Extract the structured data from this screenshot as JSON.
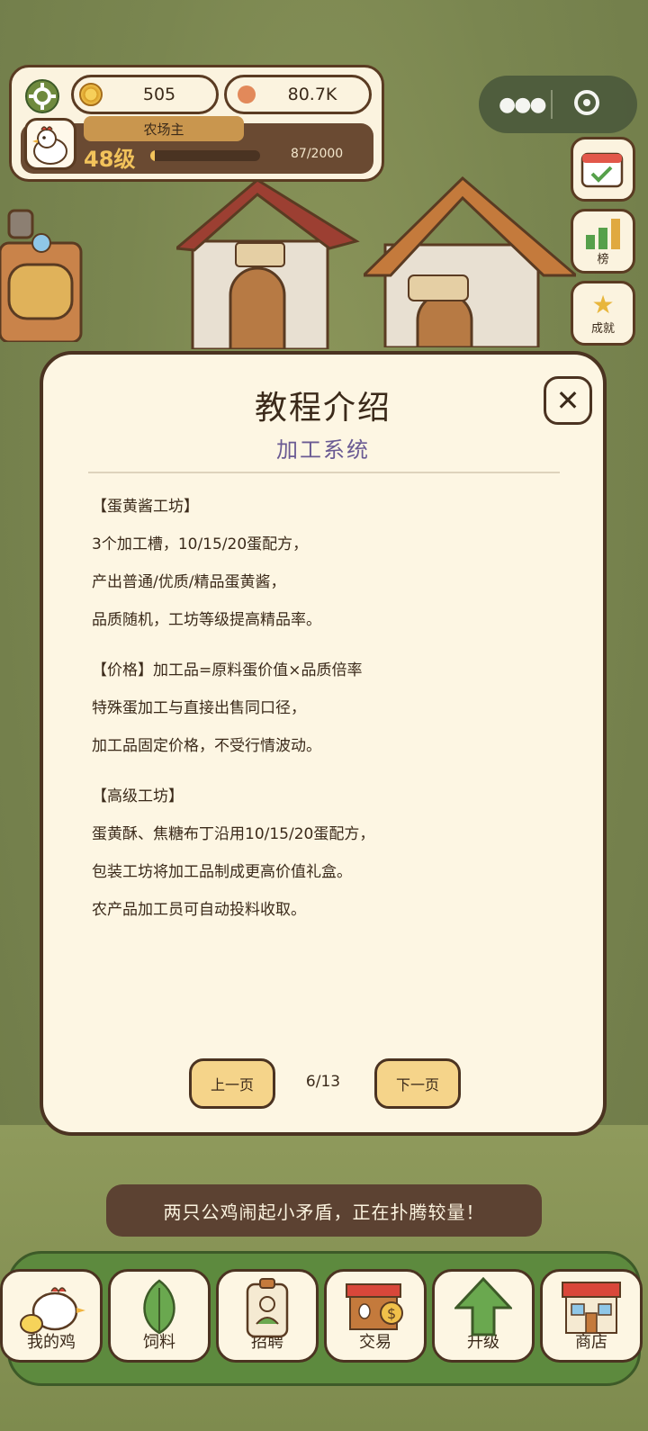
{
  "hud": {
    "coins": "505",
    "gems": "80.7K",
    "role": "农场主",
    "role_edit_icon": "",
    "level": "48级",
    "xp": "87/2000",
    "xp_fraction": 0.0435
  },
  "side": {
    "rank_label": "榜",
    "achievement_label": "成就"
  },
  "modal": {
    "title": "教程介绍",
    "subtitle": "加工系统",
    "sections": [
      [
        "【蛋黄酱工坊】",
        "3个加工槽，10/15/20蛋配方，",
        "产出普通/优质/精品蛋黄酱，",
        "品质随机，工坊等级提高精品率。"
      ],
      [
        "【价格】加工品=原料蛋价值×品质倍率",
        "特殊蛋加工与直接出售同口径，",
        "加工品固定价格，不受行情波动。"
      ],
      [
        "【高级工坊】",
        "蛋黄酥、焦糖布丁沿用10/15/20蛋配方，",
        "包装工坊将加工品制成更高价值礼盒。",
        "农产品加工员可自动投料收取。"
      ]
    ],
    "prev_label": "上一页",
    "next_label": "下一页",
    "page": "6/13"
  },
  "toast": "两只公鸡闹起小矛盾，正在扑腾较量！",
  "nav": {
    "tabs": [
      {
        "label": "我的鸡",
        "icon": "chicken-icon"
      },
      {
        "label": "饲料",
        "icon": "leaf-icon"
      },
      {
        "label": "招聘",
        "icon": "badge-icon"
      },
      {
        "label": "交易",
        "icon": "market-stall-icon"
      },
      {
        "label": "升级",
        "icon": "up-arrow-icon"
      },
      {
        "label": "商店",
        "icon": "shop-icon"
      }
    ]
  },
  "colors": {
    "panel": "#fdf6e3",
    "border": "#4b3321",
    "subtitle": "#6a5a93",
    "button": "#f5d48a",
    "nav": "#5d8a3e"
  }
}
